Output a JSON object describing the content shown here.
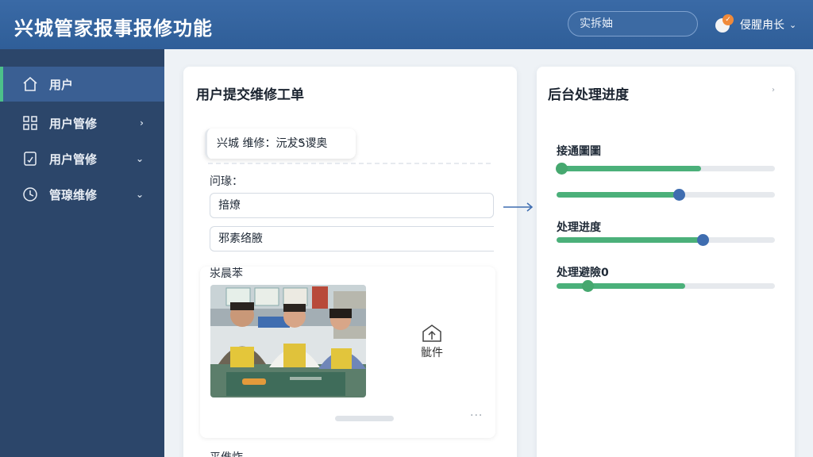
{
  "header": {
    "title": "兴城管家报事报修功能",
    "search_placeholder": "实拆妯",
    "user_name": "侵腥甪长",
    "user_badge": "✓",
    "user_chevron": "⌄"
  },
  "sidebar": {
    "items": [
      {
        "label": "用户",
        "icon": "home-icon",
        "active": true,
        "chevron": ""
      },
      {
        "label": "用户管修",
        "icon": "grid-icon",
        "chevron": "›"
      },
      {
        "label": "用户管修",
        "icon": "document-icon",
        "chevron": "⌄"
      },
      {
        "label": "管瑔维修",
        "icon": "clock-icon",
        "chevron": "⌄"
      }
    ]
  },
  "left_card": {
    "title": "用户提交维修工单",
    "chip_text": "兴城 维修：沅犮̀S谡奥",
    "issue_label": "问瑑：",
    "input1_value": "揞燎",
    "input2_value": "邪素络腋",
    "photo_label": "汖晨苯",
    "upload_label": "骴件",
    "more": "···",
    "bottom_label": "平倠炸"
  },
  "right_card": {
    "title": "后台处理进度",
    "chevron": "›",
    "progress": [
      {
        "label": "接通圖圖",
        "fill": 0.66,
        "knob": 0.02,
        "knob_color": "green"
      },
      {
        "label": "",
        "fill": 0.56,
        "knob": 0.56,
        "knob_color": "blue"
      },
      {
        "label": "处理进度",
        "fill": 0.67,
        "knob": 0.67,
        "knob_color": "blue"
      },
      {
        "label": "处理避險0",
        "fill": 0.59,
        "knob": 0.14,
        "knob_color": "green"
      }
    ]
  },
  "colors": {
    "header": "#2f5e98",
    "sidebar": "#2c466a",
    "accent_green": "#4bb07a",
    "accent_blue": "#3f6db0"
  }
}
